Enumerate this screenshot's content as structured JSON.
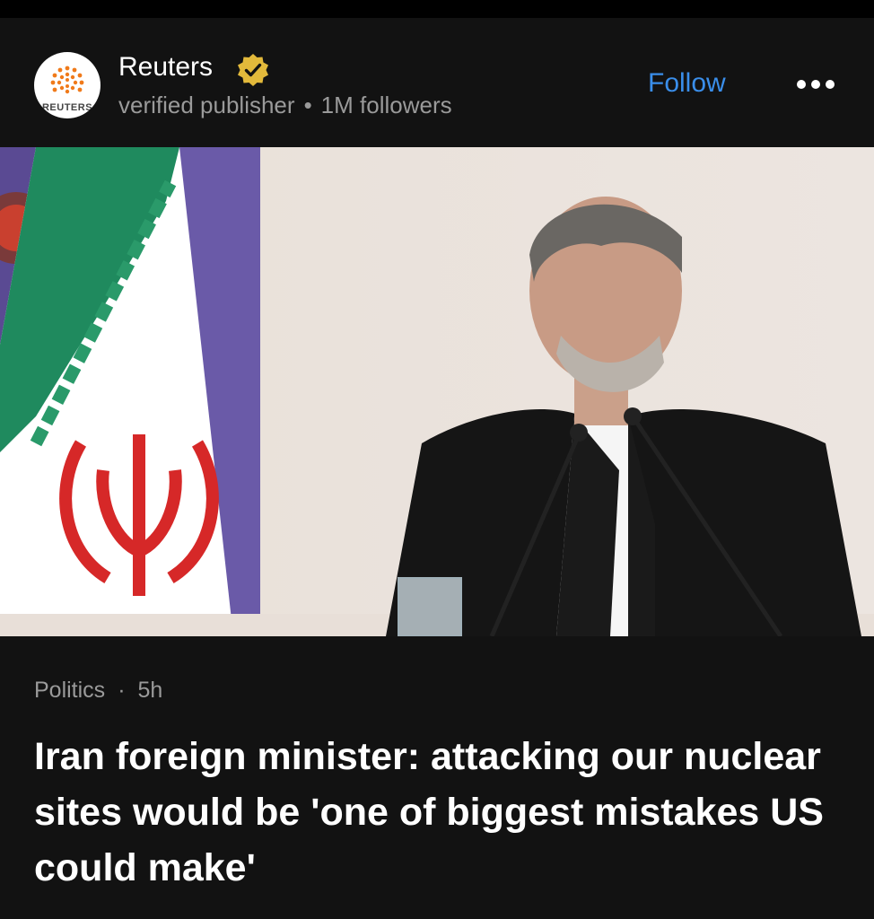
{
  "publisher": {
    "name": "Reuters",
    "logo_text": "REUTERS",
    "verified_label": "verified publisher",
    "separator": "•",
    "followers": "1M followers",
    "follow_label": "Follow",
    "more_icon": "more-horizontal-icon",
    "verified_icon": "verified-badge-icon",
    "verified_color": "#e2b93b",
    "follow_color": "#3a8eea"
  },
  "article": {
    "category": "Politics",
    "separator": "·",
    "age": "5h",
    "headline": "Iran foreign minister: attacking our nuclear sites would be 'one of biggest mistakes US could make'"
  }
}
